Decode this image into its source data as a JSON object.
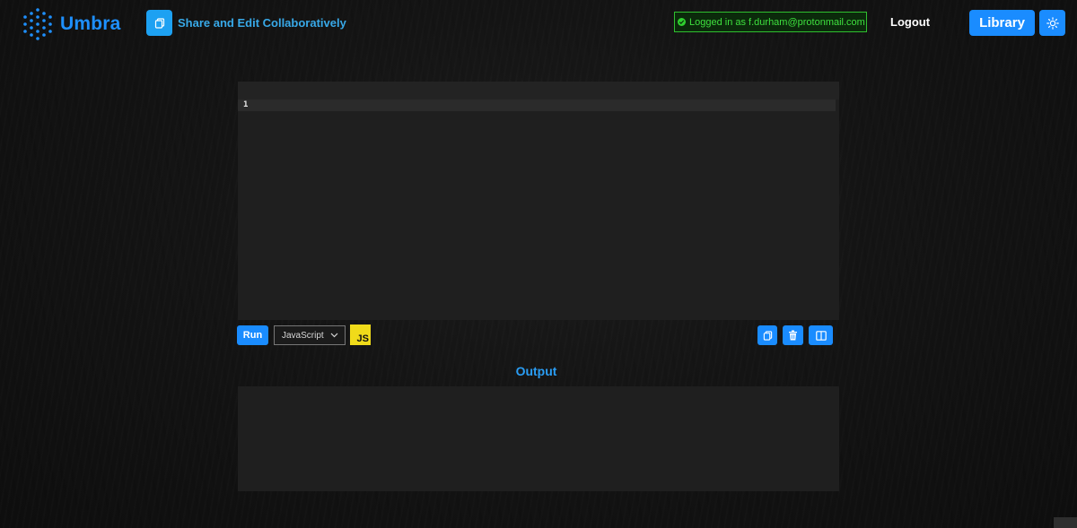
{
  "header": {
    "brand": "Umbra",
    "share_label": "Share and Edit Collaboratively",
    "status_text": "Logged in as f.durham@protonmail.com",
    "logout_label": "Logout",
    "library_label": "Library",
    "icons": {
      "logo": "hexagon-dots-logo-icon",
      "share": "copy-icon",
      "status": "check-circle-icon",
      "theme": "sun-icon"
    }
  },
  "editor": {
    "line_numbers": [
      "1"
    ]
  },
  "toolbar": {
    "run_label": "Run",
    "language": "JavaScript",
    "language_badge": "JS",
    "icons": [
      "copy-icon",
      "trash-icon",
      "split-view-icon"
    ]
  },
  "output": {
    "title": "Output"
  },
  "colors": {
    "accent": "#1a8cff",
    "status_green": "#3ee03e",
    "js_yellow": "#f0db1a",
    "panel": "#1f1f1f"
  }
}
